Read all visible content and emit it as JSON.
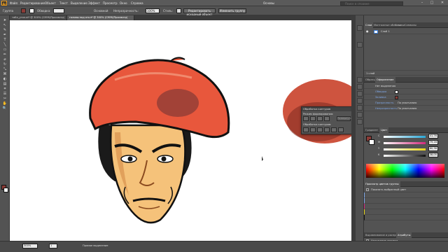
{
  "app": {
    "logo": "Ai"
  },
  "menu": [
    "Файл",
    "Редактирование",
    "Объект",
    "Текст",
    "Выделение",
    "Эффект",
    "Просмотр",
    "Окно",
    "Справка"
  ],
  "workspace_label": "Основы",
  "search": {
    "placeholder": "Поиск в справке"
  },
  "window_controls": {
    "minimize": "–",
    "restore": "□",
    "close": "✕"
  },
  "controlbar": {
    "selection_label": "Группа",
    "stroke_label": "Обводка:",
    "opacity_label": "Непрозрачность:",
    "opacity_value": "100%",
    "profile_label": "Основной",
    "style_label": "Стиль:",
    "edit_button": "Редактировать исходный объект",
    "trace_button": "Изменить группу"
  },
  "tabs": [
    "табл_угол.ai* @ 300% (CMYK/Просмотр)",
    "головы под откл* @ 300% (CMYK/Просмотр)"
  ],
  "tools": [
    "➤",
    "↖",
    "✎",
    "✒",
    "T",
    "╲",
    "▭",
    "✏",
    "⌀",
    "↻",
    "⤡",
    "⌘",
    "◐",
    "▤",
    "⌗",
    "☰",
    "✂",
    "✋",
    "🔍"
  ],
  "statusbar": {
    "zoom": "300%",
    "page": "1",
    "status_text": "Прямое выделение"
  },
  "layers_panel": {
    "tabs": [
      "Слои",
      "Монтажные области",
      "Ссылки",
      "Символы"
    ],
    "layer_name": "Слой 1",
    "footer": "1 слой"
  },
  "appearance_panel": {
    "tabs": [
      "Образцы",
      "Оформление"
    ],
    "title": "Нет выделения",
    "rows": [
      {
        "label": "Обводка",
        "value": ""
      },
      {
        "label": "Заливка",
        "value": ""
      },
      {
        "label": "Прозрачность",
        "value": "По умолчанию"
      },
      {
        "label": "Непрозрачность",
        "value": "По умолчанию"
      }
    ]
  },
  "color_panel": {
    "tabs": [
      "Градиент",
      "Цвет"
    ],
    "channels": [
      {
        "label": "C",
        "value": "41,76",
        "color": "#2aa7d6"
      },
      {
        "label": "M",
        "value": "79,16",
        "color": "#d4287c"
      },
      {
        "label": "Y",
        "value": "80,38",
        "color": "#e8d51a"
      },
      {
        "label": "K",
        "value": "38,05",
        "color": "#333333"
      }
    ],
    "fill_color": "#8b3b36"
  },
  "swatch_groups_panel": {
    "title": "Просмотр цветов группы",
    "checkbox_label": "Показать выбранный цвет",
    "rows": [
      "",
      "",
      "",
      "",
      ""
    ]
  },
  "bottom_panel": {
    "tabs": [
      "Выравнивание и распределение",
      "Атрибуты"
    ],
    "row_label": "Наложение заливки"
  },
  "float_panel": {
    "title": "Обработка контуров",
    "shape_label": "Режим формирования:",
    "pathfinder_label": "Обработка контуров:",
    "expand_button": "Развернуть"
  },
  "colors": {
    "beret": "#e8573c",
    "beret_shade": "#8b3b36",
    "skin": "#f5c27a",
    "hair": "#1a1a1a",
    "accent": "#3c7dd8"
  }
}
